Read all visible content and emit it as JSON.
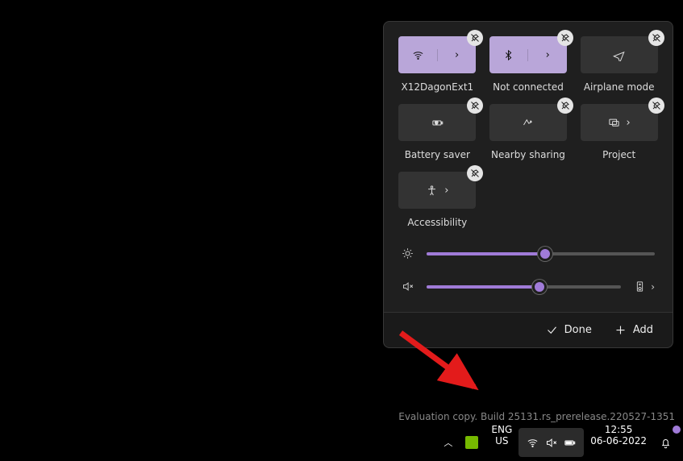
{
  "panel": {
    "tiles": [
      {
        "id": "wifi",
        "label": "X12DagonExt1",
        "style": "accent",
        "split": true,
        "icon": "wifi"
      },
      {
        "id": "bluetooth",
        "label": "Not connected",
        "style": "accent",
        "split": true,
        "icon": "bluetooth"
      },
      {
        "id": "airplane",
        "label": "Airplane mode",
        "style": "dim",
        "split": false,
        "icon": "airplane"
      },
      {
        "id": "battery-saver",
        "label": "Battery saver",
        "style": "dim",
        "split": false,
        "icon": "battery-saver"
      },
      {
        "id": "nearby",
        "label": "Nearby sharing",
        "style": "dim",
        "split": false,
        "icon": "nearby"
      },
      {
        "id": "project",
        "label": "Project",
        "style": "dim",
        "split": false,
        "icon": "project",
        "arrow": true
      },
      {
        "id": "accessibility",
        "label": "Accessibility",
        "style": "dim",
        "split": false,
        "icon": "accessibility",
        "arrow": true
      }
    ],
    "brightness_pct": 52,
    "volume_pct": 58,
    "volume_muted": true,
    "footer": {
      "done": "Done",
      "add": "Add"
    }
  },
  "taskbar": {
    "lang_top": "ENG",
    "lang_bottom": "US",
    "time": "12:55",
    "date": "06-06-2022"
  },
  "watermark": "Evaluation copy. Build 25131.rs_prerelease.220527-1351"
}
